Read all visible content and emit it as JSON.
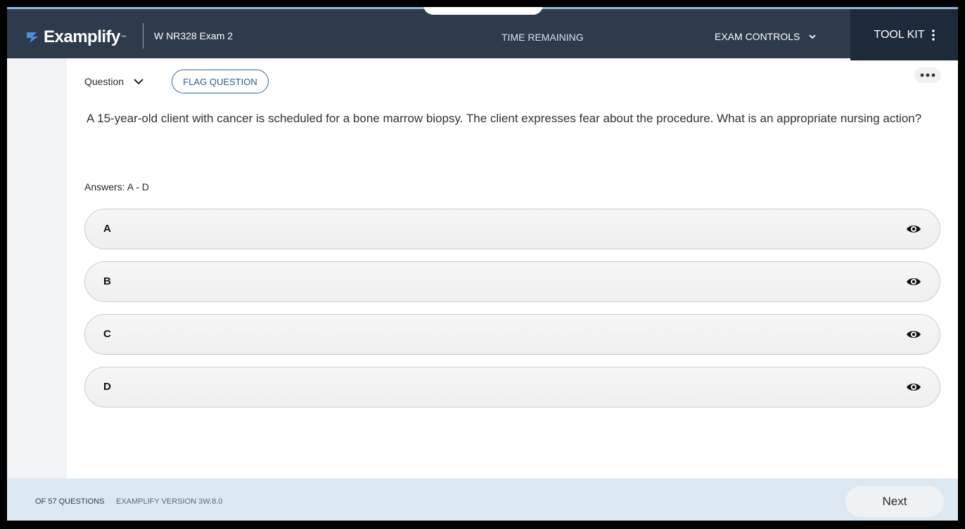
{
  "header": {
    "logo_text": "Examplify",
    "exam_title": "W NR328 Exam 2",
    "time_remaining_label": "TIME REMAINING",
    "exam_controls_label": "EXAM CONTROLS",
    "toolkit_label": "TOOL KIT"
  },
  "question": {
    "label": "Question",
    "flag_label": "FLAG QUESTION",
    "text": "A 15-year-old client with cancer is scheduled for a bone marrow biopsy. The client expresses fear about the procedure. What is an appropriate nursing action?",
    "answers_label": "Answers: A - D"
  },
  "answers": [
    {
      "letter": "A",
      "text": ""
    },
    {
      "letter": "B",
      "text": ""
    },
    {
      "letter": "C",
      "text": ""
    },
    {
      "letter": "D",
      "text": ""
    }
  ],
  "footer": {
    "question_count": "OF 57 QUESTIONS",
    "version": "EXAMPLIFY VERSION 3W.8.0",
    "next_label": "Next"
  },
  "colors": {
    "header_bg": "#2d3b4c",
    "toolkit_bg": "#1d2a3a",
    "accent_blue": "#2c6aa0",
    "logo_blue": "#4a90e2",
    "footer_bg": "#dde9f2"
  },
  "icons": {
    "logo": "examplify-logo-icon",
    "exam_controls": "chevron-down-icon",
    "toolkit": "kebab-menu-icon",
    "question_dropdown": "chevron-down-icon",
    "more": "more-horizontal-icon",
    "answer_eye": "eye-icon"
  }
}
